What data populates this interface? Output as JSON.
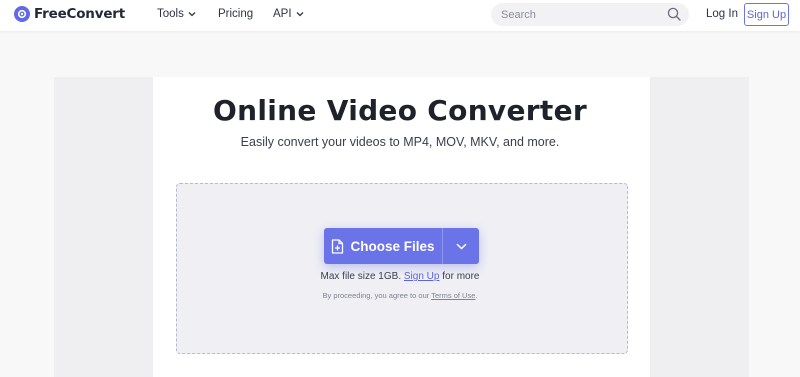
{
  "header": {
    "brand": "FreeConvert",
    "nav": {
      "tools": "Tools",
      "pricing": "Pricing",
      "api": "API"
    },
    "search": {
      "placeholder": "Search"
    },
    "login_label": "Log In",
    "signup_label": "Sign Up"
  },
  "main": {
    "title": "Online Video Converter",
    "subtitle": "Easily convert your videos to MP4, MOV, MKV, and more.",
    "dropzone": {
      "choose_files_label": "Choose Files",
      "max_size_prefix": "Max file size 1GB.",
      "max_size_link": "Sign Up",
      "max_size_suffix": "for more",
      "terms_prefix": "By proceeding, you agree to our",
      "terms_link": "Terms of Use",
      "terms_suffix": "."
    }
  },
  "colors": {
    "brand": "#5f6ae6",
    "button": "#6a73e8",
    "dropzone_bg": "#efeff4"
  },
  "icons": [
    "logo-icon",
    "chevron-down-icon",
    "search-icon",
    "file-add-icon"
  ]
}
